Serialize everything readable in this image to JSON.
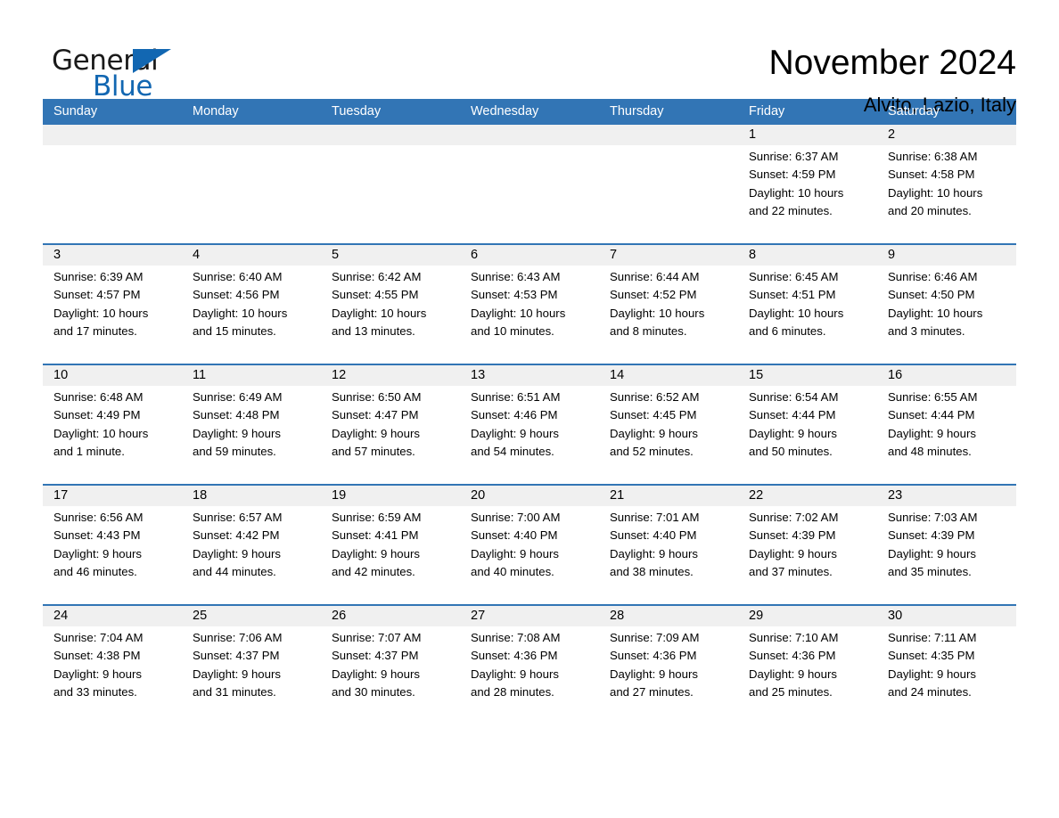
{
  "brand": {
    "name_part1": "General",
    "name_part2": "Blue",
    "accent_color": "#1267b2"
  },
  "header": {
    "month_title": "November 2024",
    "location": "Alvito, Lazio, Italy"
  },
  "calendar": {
    "header_color": "#3275b5",
    "daynum_band_color": "#f0f0f0",
    "weekdays": [
      "Sunday",
      "Monday",
      "Tuesday",
      "Wednesday",
      "Thursday",
      "Friday",
      "Saturday"
    ],
    "weeks": [
      [
        {
          "day": "",
          "sunrise": "",
          "sunset": "",
          "daylight_line1": "",
          "daylight_line2": "",
          "empty": true
        },
        {
          "day": "",
          "sunrise": "",
          "sunset": "",
          "daylight_line1": "",
          "daylight_line2": "",
          "empty": true
        },
        {
          "day": "",
          "sunrise": "",
          "sunset": "",
          "daylight_line1": "",
          "daylight_line2": "",
          "empty": true
        },
        {
          "day": "",
          "sunrise": "",
          "sunset": "",
          "daylight_line1": "",
          "daylight_line2": "",
          "empty": true
        },
        {
          "day": "",
          "sunrise": "",
          "sunset": "",
          "daylight_line1": "",
          "daylight_line2": "",
          "empty": true
        },
        {
          "day": "1",
          "sunrise": "Sunrise: 6:37 AM",
          "sunset": "Sunset: 4:59 PM",
          "daylight_line1": "Daylight: 10 hours",
          "daylight_line2": "and 22 minutes.",
          "empty": false
        },
        {
          "day": "2",
          "sunrise": "Sunrise: 6:38 AM",
          "sunset": "Sunset: 4:58 PM",
          "daylight_line1": "Daylight: 10 hours",
          "daylight_line2": "and 20 minutes.",
          "empty": false
        }
      ],
      [
        {
          "day": "3",
          "sunrise": "Sunrise: 6:39 AM",
          "sunset": "Sunset: 4:57 PM",
          "daylight_line1": "Daylight: 10 hours",
          "daylight_line2": "and 17 minutes.",
          "empty": false
        },
        {
          "day": "4",
          "sunrise": "Sunrise: 6:40 AM",
          "sunset": "Sunset: 4:56 PM",
          "daylight_line1": "Daylight: 10 hours",
          "daylight_line2": "and 15 minutes.",
          "empty": false
        },
        {
          "day": "5",
          "sunrise": "Sunrise: 6:42 AM",
          "sunset": "Sunset: 4:55 PM",
          "daylight_line1": "Daylight: 10 hours",
          "daylight_line2": "and 13 minutes.",
          "empty": false
        },
        {
          "day": "6",
          "sunrise": "Sunrise: 6:43 AM",
          "sunset": "Sunset: 4:53 PM",
          "daylight_line1": "Daylight: 10 hours",
          "daylight_line2": "and 10 minutes.",
          "empty": false
        },
        {
          "day": "7",
          "sunrise": "Sunrise: 6:44 AM",
          "sunset": "Sunset: 4:52 PM",
          "daylight_line1": "Daylight: 10 hours",
          "daylight_line2": "and 8 minutes.",
          "empty": false
        },
        {
          "day": "8",
          "sunrise": "Sunrise: 6:45 AM",
          "sunset": "Sunset: 4:51 PM",
          "daylight_line1": "Daylight: 10 hours",
          "daylight_line2": "and 6 minutes.",
          "empty": false
        },
        {
          "day": "9",
          "sunrise": "Sunrise: 6:46 AM",
          "sunset": "Sunset: 4:50 PM",
          "daylight_line1": "Daylight: 10 hours",
          "daylight_line2": "and 3 minutes.",
          "empty": false
        }
      ],
      [
        {
          "day": "10",
          "sunrise": "Sunrise: 6:48 AM",
          "sunset": "Sunset: 4:49 PM",
          "daylight_line1": "Daylight: 10 hours",
          "daylight_line2": "and 1 minute.",
          "empty": false
        },
        {
          "day": "11",
          "sunrise": "Sunrise: 6:49 AM",
          "sunset": "Sunset: 4:48 PM",
          "daylight_line1": "Daylight: 9 hours",
          "daylight_line2": "and 59 minutes.",
          "empty": false
        },
        {
          "day": "12",
          "sunrise": "Sunrise: 6:50 AM",
          "sunset": "Sunset: 4:47 PM",
          "daylight_line1": "Daylight: 9 hours",
          "daylight_line2": "and 57 minutes.",
          "empty": false
        },
        {
          "day": "13",
          "sunrise": "Sunrise: 6:51 AM",
          "sunset": "Sunset: 4:46 PM",
          "daylight_line1": "Daylight: 9 hours",
          "daylight_line2": "and 54 minutes.",
          "empty": false
        },
        {
          "day": "14",
          "sunrise": "Sunrise: 6:52 AM",
          "sunset": "Sunset: 4:45 PM",
          "daylight_line1": "Daylight: 9 hours",
          "daylight_line2": "and 52 minutes.",
          "empty": false
        },
        {
          "day": "15",
          "sunrise": "Sunrise: 6:54 AM",
          "sunset": "Sunset: 4:44 PM",
          "daylight_line1": "Daylight: 9 hours",
          "daylight_line2": "and 50 minutes.",
          "empty": false
        },
        {
          "day": "16",
          "sunrise": "Sunrise: 6:55 AM",
          "sunset": "Sunset: 4:44 PM",
          "daylight_line1": "Daylight: 9 hours",
          "daylight_line2": "and 48 minutes.",
          "empty": false
        }
      ],
      [
        {
          "day": "17",
          "sunrise": "Sunrise: 6:56 AM",
          "sunset": "Sunset: 4:43 PM",
          "daylight_line1": "Daylight: 9 hours",
          "daylight_line2": "and 46 minutes.",
          "empty": false
        },
        {
          "day": "18",
          "sunrise": "Sunrise: 6:57 AM",
          "sunset": "Sunset: 4:42 PM",
          "daylight_line1": "Daylight: 9 hours",
          "daylight_line2": "and 44 minutes.",
          "empty": false
        },
        {
          "day": "19",
          "sunrise": "Sunrise: 6:59 AM",
          "sunset": "Sunset: 4:41 PM",
          "daylight_line1": "Daylight: 9 hours",
          "daylight_line2": "and 42 minutes.",
          "empty": false
        },
        {
          "day": "20",
          "sunrise": "Sunrise: 7:00 AM",
          "sunset": "Sunset: 4:40 PM",
          "daylight_line1": "Daylight: 9 hours",
          "daylight_line2": "and 40 minutes.",
          "empty": false
        },
        {
          "day": "21",
          "sunrise": "Sunrise: 7:01 AM",
          "sunset": "Sunset: 4:40 PM",
          "daylight_line1": "Daylight: 9 hours",
          "daylight_line2": "and 38 minutes.",
          "empty": false
        },
        {
          "day": "22",
          "sunrise": "Sunrise: 7:02 AM",
          "sunset": "Sunset: 4:39 PM",
          "daylight_line1": "Daylight: 9 hours",
          "daylight_line2": "and 37 minutes.",
          "empty": false
        },
        {
          "day": "23",
          "sunrise": "Sunrise: 7:03 AM",
          "sunset": "Sunset: 4:39 PM",
          "daylight_line1": "Daylight: 9 hours",
          "daylight_line2": "and 35 minutes.",
          "empty": false
        }
      ],
      [
        {
          "day": "24",
          "sunrise": "Sunrise: 7:04 AM",
          "sunset": "Sunset: 4:38 PM",
          "daylight_line1": "Daylight: 9 hours",
          "daylight_line2": "and 33 minutes.",
          "empty": false
        },
        {
          "day": "25",
          "sunrise": "Sunrise: 7:06 AM",
          "sunset": "Sunset: 4:37 PM",
          "daylight_line1": "Daylight: 9 hours",
          "daylight_line2": "and 31 minutes.",
          "empty": false
        },
        {
          "day": "26",
          "sunrise": "Sunrise: 7:07 AM",
          "sunset": "Sunset: 4:37 PM",
          "daylight_line1": "Daylight: 9 hours",
          "daylight_line2": "and 30 minutes.",
          "empty": false
        },
        {
          "day": "27",
          "sunrise": "Sunrise: 7:08 AM",
          "sunset": "Sunset: 4:36 PM",
          "daylight_line1": "Daylight: 9 hours",
          "daylight_line2": "and 28 minutes.",
          "empty": false
        },
        {
          "day": "28",
          "sunrise": "Sunrise: 7:09 AM",
          "sunset": "Sunset: 4:36 PM",
          "daylight_line1": "Daylight: 9 hours",
          "daylight_line2": "and 27 minutes.",
          "empty": false
        },
        {
          "day": "29",
          "sunrise": "Sunrise: 7:10 AM",
          "sunset": "Sunset: 4:36 PM",
          "daylight_line1": "Daylight: 9 hours",
          "daylight_line2": "and 25 minutes.",
          "empty": false
        },
        {
          "day": "30",
          "sunrise": "Sunrise: 7:11 AM",
          "sunset": "Sunset: 4:35 PM",
          "daylight_line1": "Daylight: 9 hours",
          "daylight_line2": "and 24 minutes.",
          "empty": false
        }
      ]
    ]
  }
}
